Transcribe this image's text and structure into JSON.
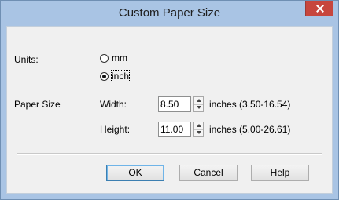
{
  "dialog": {
    "title": "Custom Paper Size",
    "close_label": "×"
  },
  "units": {
    "label": "Units:",
    "options": [
      {
        "label": "mm",
        "selected": false
      },
      {
        "label": "inch",
        "selected": true
      }
    ]
  },
  "paper_size": {
    "label": "Paper Size",
    "width": {
      "label": "Width:",
      "value": "8.50",
      "range": "inches (3.50-16.54)"
    },
    "height": {
      "label": "Height:",
      "value": "11.00",
      "range": "inches (5.00-26.61)"
    }
  },
  "buttons": {
    "ok": "OK",
    "cancel": "Cancel",
    "help": "Help"
  },
  "colors": {
    "title_bar": "#a9c4e4",
    "close_button": "#c7463d",
    "client_background": "#f0f0f0"
  }
}
